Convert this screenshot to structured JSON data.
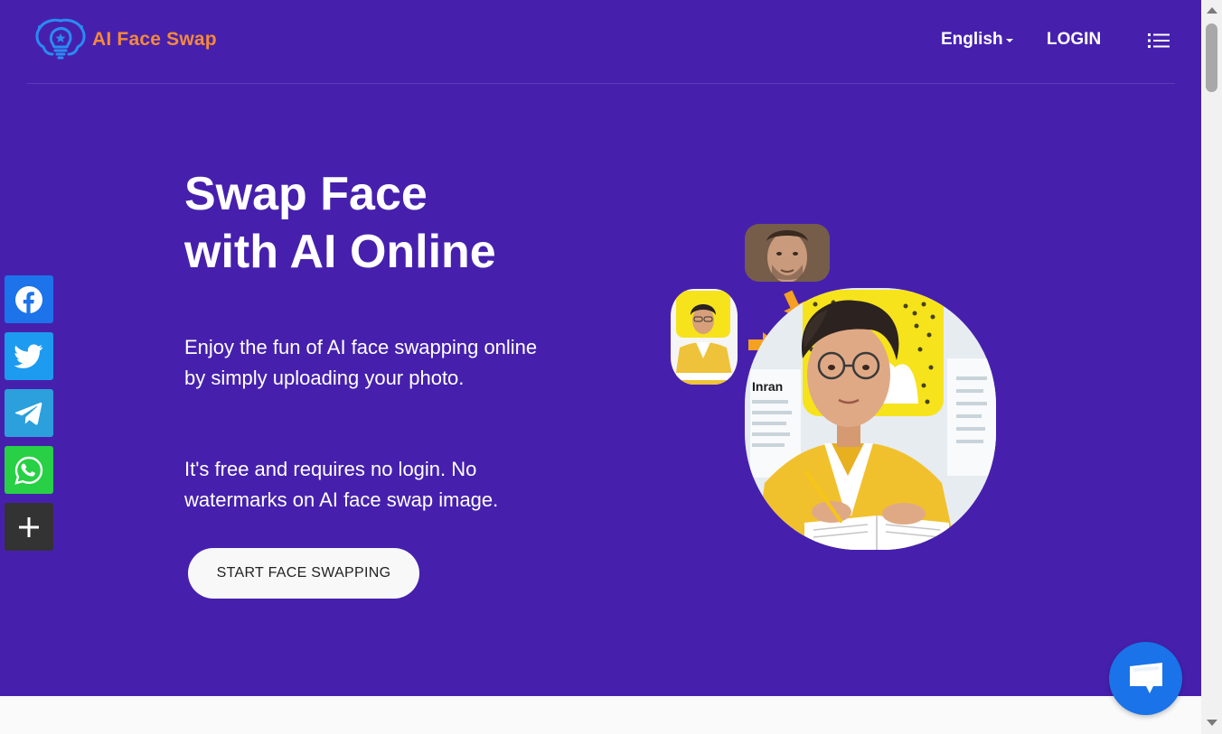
{
  "header": {
    "logo_text": "AI Face Swap",
    "language": "English",
    "login": "LOGIN",
    "menu_icon": "list-menu-icon"
  },
  "hero": {
    "title_line1": "Swap Face",
    "title_line2": "with AI Online",
    "description1": "Enjoy the fun of AI face swapping online by simply uploading your photo.",
    "description2": "It's free and requires no login. No watermarks on AI face swap image.",
    "cta_label": "START FACE SWAPPING",
    "illustration_label": "Inran"
  },
  "share_bar": [
    {
      "name": "facebook",
      "icon": "facebook-icon",
      "color": "#1d73ea"
    },
    {
      "name": "twitter",
      "icon": "twitter-icon",
      "color": "#1d9bf0"
    },
    {
      "name": "telegram",
      "icon": "telegram-icon",
      "color": "#2ba0dc"
    },
    {
      "name": "whatsapp",
      "icon": "whatsapp-icon",
      "color": "#27d045"
    },
    {
      "name": "more",
      "icon": "plus-icon",
      "color": "#333333"
    }
  ],
  "chat": {
    "icon": "chat-bubble-icon",
    "color": "#1a73e8"
  },
  "colors": {
    "hero_bg": "#4620ad",
    "logo_orange": "#f5893a",
    "logo_blue": "#2a8bf2"
  }
}
